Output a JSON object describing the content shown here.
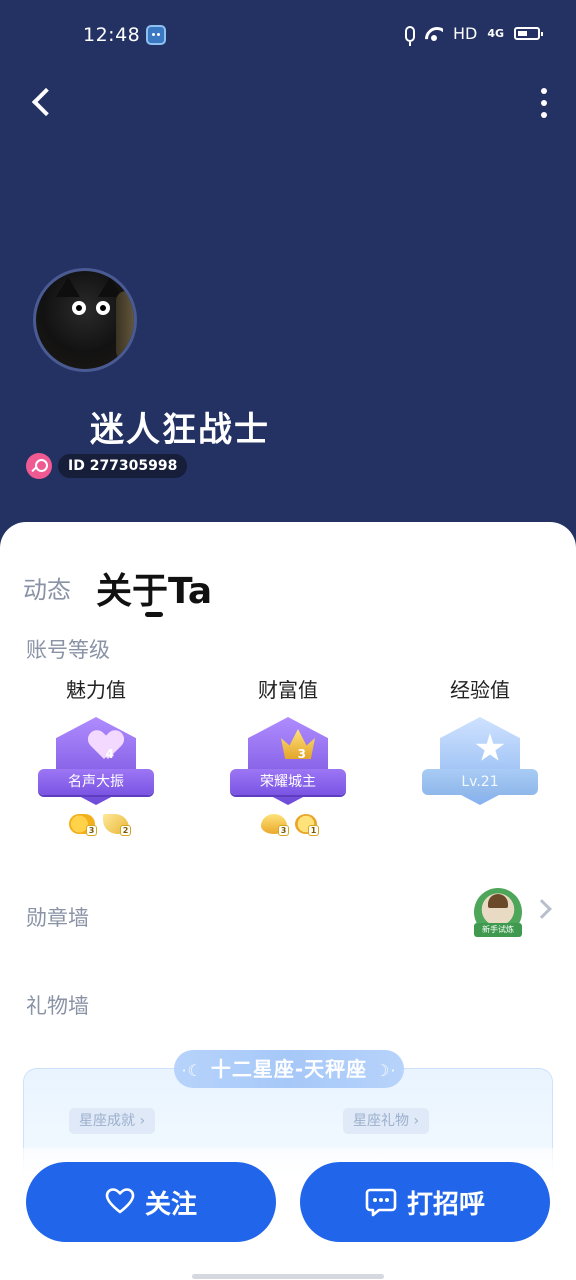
{
  "status_bar": {
    "time": "12:48",
    "hd": "HD",
    "network": "4G"
  },
  "profile": {
    "nickname": "迷人狂战士",
    "id_label": "ID 277305998",
    "gender": "female"
  },
  "tabs": [
    {
      "label": "动态",
      "active": false
    },
    {
      "label": "关于Ta",
      "active": true
    }
  ],
  "account_level": {
    "title": "账号等级",
    "items": [
      {
        "label": "魅力值",
        "badge_text": "名声大振",
        "level": "4",
        "icon": "heart-icon",
        "color": "#8a63ea"
      },
      {
        "label": "财富值",
        "badge_text": "荣耀城主",
        "level": "3",
        "icon": "crown-icon",
        "color": "#8a63ea"
      },
      {
        "label": "经验值",
        "badge_text": "Lv.21",
        "icon": "star-icon",
        "color": "#9fc4f2"
      }
    ],
    "charm_minis": [
      "3",
      "2"
    ],
    "wealth_minis": [
      "3",
      "1"
    ]
  },
  "medal_wall": {
    "title": "勋章墙",
    "medal_name": "新手试炼"
  },
  "gift_wall": {
    "title": "礼物墙",
    "zodiac_title": "十二星座-天秤座",
    "tag_achievement": "星座成就 ›",
    "tag_gift": "星座礼物 ›"
  },
  "actions": {
    "follow": "关注",
    "greet": "打招呼"
  },
  "colors": {
    "header_bg": "#233163",
    "primary_button": "#2165ea"
  }
}
